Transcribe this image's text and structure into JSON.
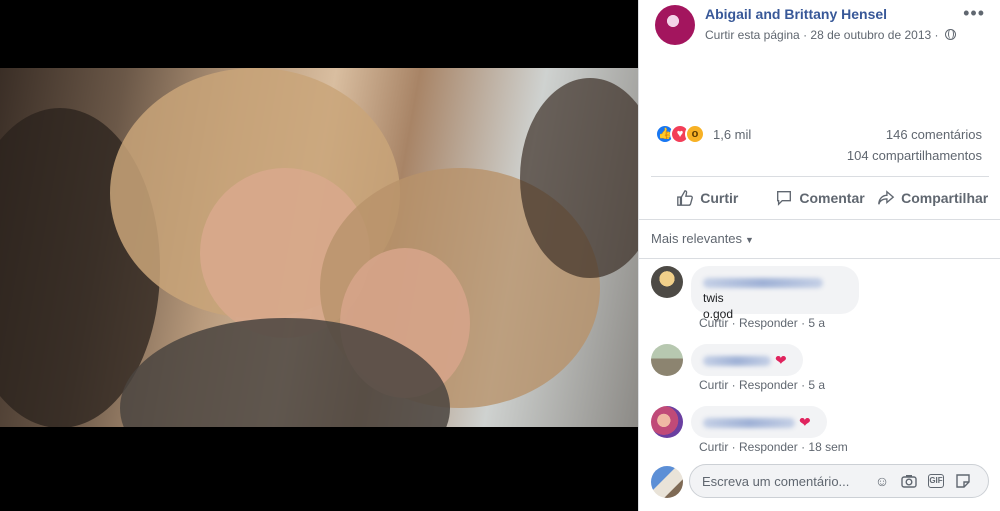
{
  "post": {
    "page_name": "Abigail and Brittany Hensel",
    "like_page": "Curtir esta página",
    "separator": "·",
    "date": "28 de outubro de 2013",
    "more_label": "•••"
  },
  "stats": {
    "reaction_count": "1,6 mil",
    "comments": "146 comentários",
    "shares": "104 compartilhamentos",
    "reactions": [
      "like-icon",
      "love-icon",
      "wow-icon"
    ]
  },
  "actions": {
    "like": "Curtir",
    "comment": "Comentar",
    "share": "Compartilhar"
  },
  "comments_section": {
    "sort_label": "Mais relevantes",
    "items": [
      {
        "text_line1": "twis",
        "text_line2": "o.god",
        "like": "Curtir",
        "reply": "Responder",
        "time": "5 a",
        "has_heart": false
      },
      {
        "text_line1": "",
        "text_line2": "",
        "like": "Curtir",
        "reply": "Responder",
        "time": "5 a",
        "has_heart": true
      },
      {
        "text_line1": "",
        "text_line2": "",
        "like": "Curtir",
        "reply": "Responder",
        "time": "18 sem",
        "has_heart": true
      }
    ],
    "heart_glyph": "❤",
    "input_placeholder": "Escreva um comentário..."
  },
  "colors": {
    "link_blue": "#385898",
    "meta_gray": "#606770",
    "bubble_bg": "#f2f3f5",
    "heart": "#e0245e"
  }
}
